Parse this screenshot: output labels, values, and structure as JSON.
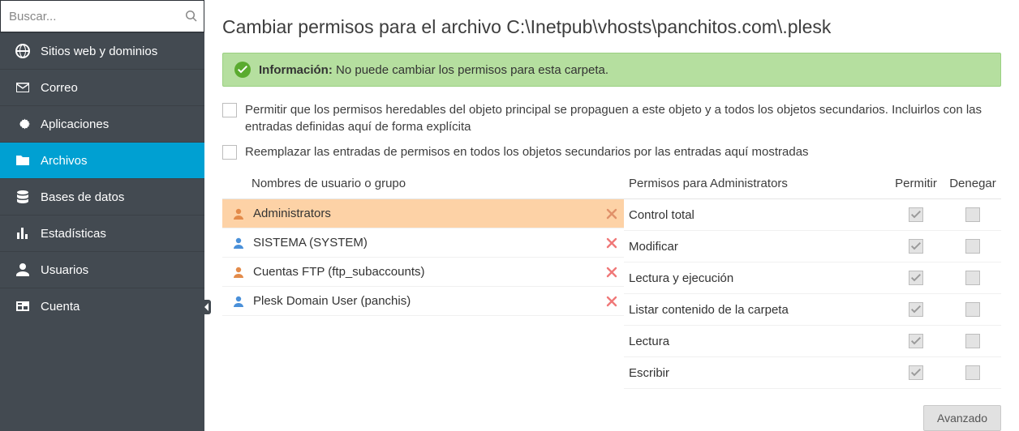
{
  "search": {
    "placeholder": "Buscar..."
  },
  "sidebar": {
    "items": [
      {
        "label": "Sitios web y dominios",
        "icon": "globe"
      },
      {
        "label": "Correo",
        "icon": "mail"
      },
      {
        "label": "Aplicaciones",
        "icon": "gear"
      },
      {
        "label": "Archivos",
        "icon": "folder",
        "active": true
      },
      {
        "label": "Bases de datos",
        "icon": "database"
      },
      {
        "label": "Estadísticas",
        "icon": "stats"
      },
      {
        "label": "Usuarios",
        "icon": "user"
      },
      {
        "label": "Cuenta",
        "icon": "card"
      }
    ]
  },
  "page": {
    "title": "Cambiar permisos para el archivo C:\\Inetpub\\vhosts\\panchitos.com\\.plesk"
  },
  "info": {
    "label": "Información:",
    "text": "No puede cambiar los permisos para esta carpeta."
  },
  "options": [
    "Permitir que los permisos heredables del objeto principal se propaguen a este objeto y a todos los objetos secundarios. Incluirlos con las entradas definidas aquí de forma explícita",
    "Reemplazar las entradas de permisos en todos los objetos secundarios por las entradas aquí mostradas"
  ],
  "users_header": "Nombres de usuario o grupo",
  "perm_header": "Permisos para Administrators",
  "allow_label": "Permitir",
  "deny_label": "Denegar",
  "users": [
    {
      "name": "Administrators",
      "color": "#e38b4a",
      "selected": true
    },
    {
      "name": "SISTEMA (SYSTEM)",
      "color": "#4a90d9"
    },
    {
      "name": "Cuentas FTP (ftp_subaccounts)",
      "color": "#e38b4a"
    },
    {
      "name": "Plesk Domain User (panchis)",
      "color": "#4a90d9"
    }
  ],
  "permissions": [
    {
      "name": "Control total",
      "allow": true,
      "deny": false
    },
    {
      "name": "Modificar",
      "allow": true,
      "deny": false
    },
    {
      "name": "Lectura y ejecución",
      "allow": true,
      "deny": false
    },
    {
      "name": "Listar contenido de la carpeta",
      "allow": true,
      "deny": false
    },
    {
      "name": "Lectura",
      "allow": true,
      "deny": false
    },
    {
      "name": "Escribir",
      "allow": true,
      "deny": false
    }
  ],
  "advanced_label": "Avanzado"
}
